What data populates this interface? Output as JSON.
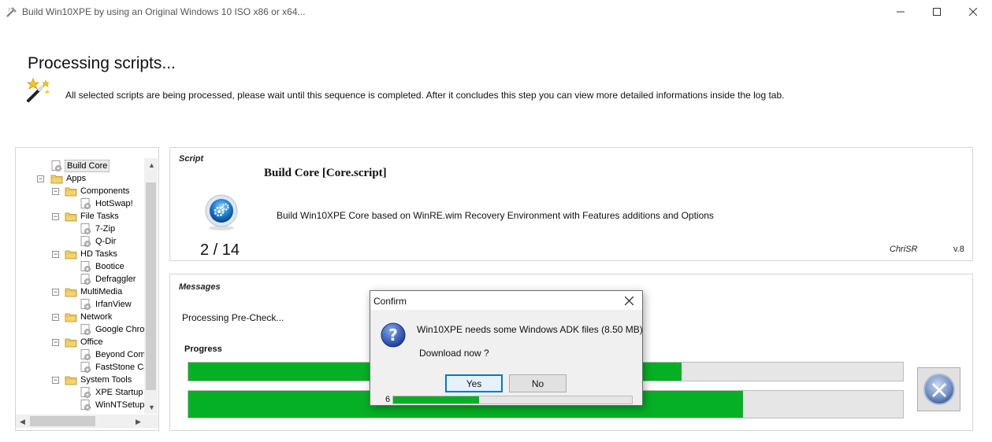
{
  "window": {
    "title": "Build Win10XPE by using an Original Windows 10 ISO x86 or x64...",
    "controls": {
      "minimize_icon": "minimize-icon",
      "maximize_icon": "maximize-icon",
      "close_icon": "close-icon"
    }
  },
  "header": {
    "title": "Processing scripts...",
    "description": "All selected scripts are being processed, please wait until this sequence is completed. After it concludes this step you can view more detailed informations inside the log tab.",
    "icon": "magic-wand-icon"
  },
  "tree": {
    "items": [
      {
        "label": "Build Core",
        "icon": "script-gear-icon",
        "level": 1,
        "selected": true
      },
      {
        "label": "Apps",
        "icon": "folder-icon",
        "level": 1,
        "expanded": true
      },
      {
        "label": "Components",
        "icon": "folder-icon",
        "level": 2,
        "expanded": true
      },
      {
        "label": "HotSwap!",
        "icon": "script-gear-icon",
        "level": 3
      },
      {
        "label": "File Tasks",
        "icon": "folder-icon",
        "level": 2,
        "expanded": true
      },
      {
        "label": "7-Zip",
        "icon": "script-gear-icon",
        "level": 3
      },
      {
        "label": "Q-Dir",
        "icon": "script-gear-icon",
        "level": 3
      },
      {
        "label": "HD Tasks",
        "icon": "folder-icon",
        "level": 2,
        "expanded": true
      },
      {
        "label": "Bootice",
        "icon": "script-gear-icon",
        "level": 3
      },
      {
        "label": "Defraggler",
        "icon": "script-gear-icon",
        "level": 3
      },
      {
        "label": "MultiMedia",
        "icon": "folder-icon",
        "level": 2,
        "expanded": true
      },
      {
        "label": "IrfanView",
        "icon": "script-gear-icon",
        "level": 3
      },
      {
        "label": "Network",
        "icon": "folder-icon",
        "level": 2,
        "expanded": true
      },
      {
        "label": "Google Chron",
        "icon": "script-gear-icon",
        "level": 3
      },
      {
        "label": "Office",
        "icon": "folder-icon",
        "level": 2,
        "expanded": true
      },
      {
        "label": "Beyond Comp",
        "icon": "script-gear-icon",
        "level": 3
      },
      {
        "label": "FastStone Ca",
        "icon": "script-gear-icon",
        "level": 3
      },
      {
        "label": "System Tools",
        "icon": "folder-icon",
        "level": 2,
        "expanded": true
      },
      {
        "label": "XPE Startup",
        "icon": "script-gear-icon",
        "level": 3
      },
      {
        "label": "WinNTSetup",
        "icon": "script-gear-icon",
        "level": 3
      }
    ]
  },
  "script": {
    "caption": "Script",
    "name": "Build Core [Core.script]",
    "description": "Build Win10XPE Core based on WinRE.wim Recovery Environment with Features additions and Options",
    "counter": "2 / 14",
    "author": "ChriSR",
    "version": "v.8",
    "icon": "gear-orb-icon"
  },
  "messages": {
    "caption": "Messages",
    "text": "Processing Pre-Check...",
    "progress_label": "Progress",
    "progress_script": 0.69,
    "progress_total": 0.776,
    "cancel_icon": "cancel-x-icon"
  },
  "dialog": {
    "title": "Confirm",
    "message": "Win10XPE needs some Windows ADK files (8.50 MB)",
    "prompt": "Download now ?",
    "yes_label": "Yes",
    "no_label": "No",
    "countdown": "6",
    "countdown_progress": 0.36,
    "icon": "question-icon"
  },
  "colors": {
    "progress_green": "#06b025",
    "accent_blue": "#0078d7"
  }
}
